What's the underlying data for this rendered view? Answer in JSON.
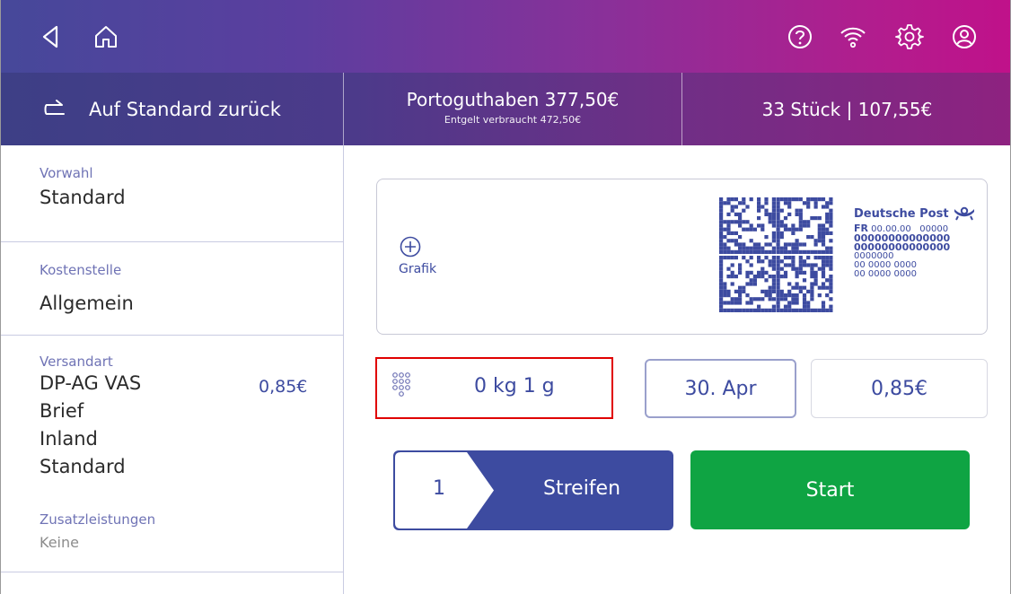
{
  "topbar": {
    "icons": [
      "back-icon",
      "home-icon",
      "help-icon",
      "wifi-icon",
      "settings-icon",
      "account-icon"
    ]
  },
  "status": {
    "reset_label": "Auf Standard zurück",
    "balance": "Portoguthaben 377,50€",
    "used": "Entgelt verbraucht 472,50€",
    "count": "33 Stück | 107,55€"
  },
  "sidebar": {
    "vorwahl": {
      "caption": "Vorwahl",
      "value": "Standard"
    },
    "kostenstelle": {
      "caption": "Kostenstelle",
      "value": "Allgemein"
    },
    "versandart": {
      "caption": "Versandart",
      "lines": [
        "DP-AG VAS",
        "Brief",
        "Inland",
        "Standard"
      ],
      "price": "0,85€",
      "extras_caption": "Zusatzleistungen",
      "extras_value": "Keine"
    }
  },
  "preview": {
    "graphic_label": "Grafik",
    "brand": "Deutsche Post",
    "fr_label": "FR",
    "fr_value": "00.00.00   00000",
    "line1": "00000000000000",
    "line2": "00000000000000",
    "line3": "0000000",
    "line4": "00 0000 0000",
    "line5": "00 0000 0000"
  },
  "controls": {
    "weight": "0 kg 1 g",
    "date": "30. Apr",
    "postage": "0,85€",
    "strip_count": "1",
    "strip_label": "Streifen",
    "start_label": "Start"
  },
  "colors": {
    "accent": "#3d4ba0",
    "start": "#0fa443",
    "highlight": "#e00000"
  }
}
